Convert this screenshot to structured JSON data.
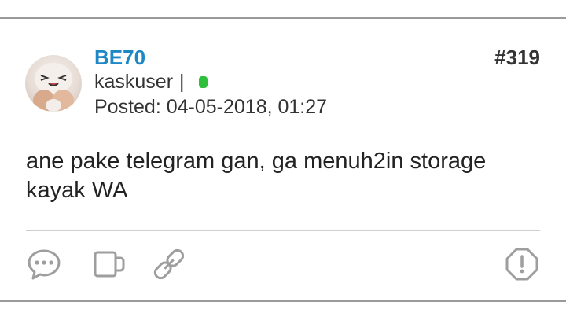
{
  "post": {
    "username": "BE70",
    "post_number": "#319",
    "role": "kaskuser",
    "role_separator": "|",
    "online_status_color": "#2fbf3a",
    "posted": "Posted: 04-05-2018, 01:27",
    "body": "ane pake telegram gan, ga menuh2in storage kayak WA"
  },
  "actions": {
    "icons": [
      "comment-icon",
      "quote-icon",
      "link-icon",
      "report-icon"
    ]
  },
  "colors": {
    "username": "#1e88c6",
    "icon": "#9e9e9e"
  }
}
